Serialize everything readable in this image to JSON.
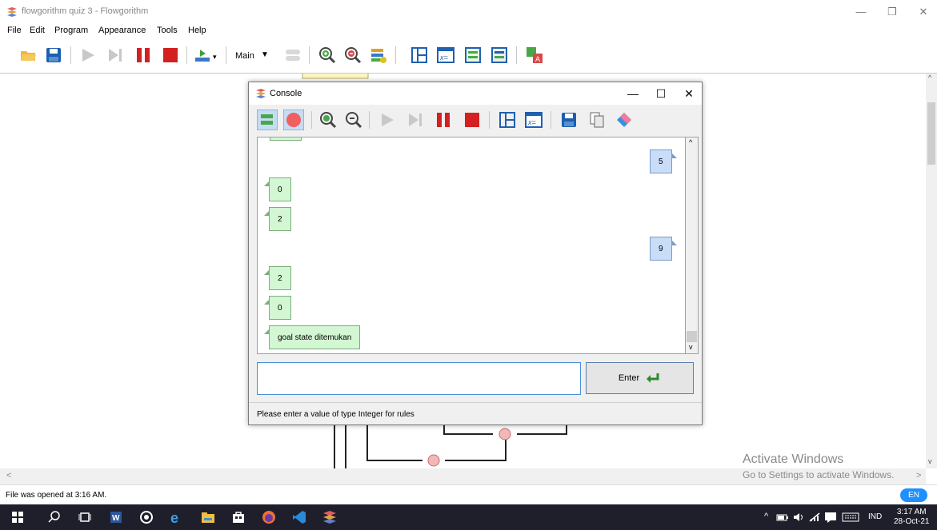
{
  "window": {
    "title": "flowgorithm quiz 3 - Flowgorithm"
  },
  "menu": [
    "File",
    "Edit",
    "Program",
    "Appearance",
    "Tools",
    "Help"
  ],
  "toolbar": {
    "function_select": "Main"
  },
  "console": {
    "title": "Console",
    "outputs": [
      {
        "kind": "output",
        "text": "0"
      },
      {
        "kind": "output",
        "text": "2"
      },
      {
        "kind": "input",
        "text": "5"
      },
      {
        "kind": "input",
        "text": "9"
      },
      {
        "kind": "output",
        "text": "2"
      },
      {
        "kind": "output",
        "text": "0"
      },
      {
        "kind": "output",
        "text": "goal state ditemukan"
      }
    ],
    "input_value": "",
    "enter_label": "Enter",
    "status": "Please enter a value of type Integer for rules"
  },
  "status_bar": {
    "message": "File was opened at 3:16 AM.",
    "language": "EN"
  },
  "watermark": {
    "line1": "Activate Windows",
    "line2": "Go to Settings to activate Windows."
  },
  "taskbar": {
    "input_indicator": "IND",
    "time": "3:17 AM",
    "date": "28-Oct-21"
  },
  "colors": {
    "output_bubble": "#d3f6d3",
    "input_bubble": "#c9dcf8",
    "accent": "#1e90ff",
    "taskbar": "#1f1f2b"
  },
  "icons": [
    "flowgorithm-icon",
    "open-folder-icon",
    "save-icon",
    "run-icon",
    "step-icon",
    "pause-icon",
    "stop-icon",
    "zoom-in-icon",
    "zoom-out-icon",
    "variable-watch-icon",
    "console-icon",
    "enter-icon"
  ]
}
